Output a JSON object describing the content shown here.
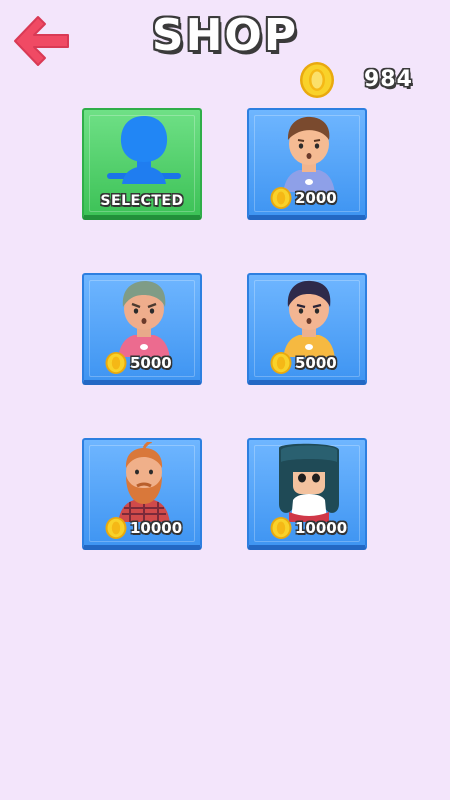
{
  "header": {
    "title": "SHOP",
    "coins": "984"
  },
  "colors": {
    "background": "#f3e5fb",
    "back_arrow": "#f04a64",
    "card_blue": "#4aa2f7",
    "card_selected": "#4ccc66",
    "coin": "#f5c71a"
  },
  "shop": {
    "items": [
      {
        "status": "SELECTED",
        "avatar": "blue-silhouette-icon"
      },
      {
        "price": "2000",
        "avatar": "boy-blue-shirt-icon"
      },
      {
        "price": "5000",
        "avatar": "boy-green-hair-pink-shirt-icon"
      },
      {
        "price": "5000",
        "avatar": "boy-dark-hair-yellow-shirt-icon"
      },
      {
        "price": "10000",
        "avatar": "bearded-man-icon"
      },
      {
        "price": "10000",
        "avatar": "girl-long-hair-icon"
      }
    ]
  }
}
